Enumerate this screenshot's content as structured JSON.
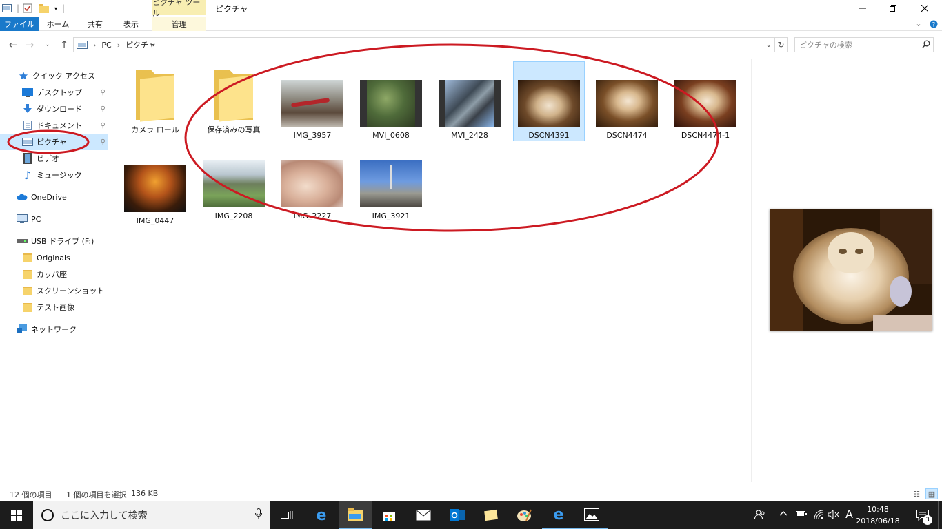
{
  "window": {
    "title": "ピクチャ",
    "context_tab_header": "ピクチャ ツール"
  },
  "ribbon": {
    "tabs": [
      "ファイル",
      "ホーム",
      "共有",
      "表示",
      "管理"
    ]
  },
  "address": {
    "path": [
      "PC",
      "ピクチャ"
    ]
  },
  "search": {
    "placeholder": "ピクチャの検索"
  },
  "nav_pane": {
    "items": [
      {
        "label": "クイック アクセス",
        "icon": "star-icon"
      },
      {
        "label": "デスクトップ",
        "icon": "desktop-icon",
        "pinned": true
      },
      {
        "label": "ダウンロード",
        "icon": "download-icon",
        "pinned": true
      },
      {
        "label": "ドキュメント",
        "icon": "document-icon",
        "pinned": true
      },
      {
        "label": "ピクチャ",
        "icon": "pictures-icon",
        "pinned": true,
        "selected": true
      },
      {
        "label": "ビデオ",
        "icon": "video-icon"
      },
      {
        "label": "ミュージック",
        "icon": "music-icon"
      },
      {
        "label": "OneDrive",
        "icon": "cloud-icon"
      },
      {
        "label": "PC",
        "icon": "pc-icon"
      },
      {
        "label": "USB ドライブ (F:)",
        "icon": "usb-drive-icon"
      },
      {
        "label": "Originals",
        "icon": "folder-icon"
      },
      {
        "label": "カッパ座",
        "icon": "folder-icon"
      },
      {
        "label": "スクリーンショット",
        "icon": "folder-icon"
      },
      {
        "label": "テスト画像",
        "icon": "folder-icon"
      },
      {
        "label": "ネットワーク",
        "icon": "network-icon"
      }
    ]
  },
  "files": [
    {
      "name": "カメラ ロール",
      "type": "folder"
    },
    {
      "name": "保存済みの写真",
      "type": "folder"
    },
    {
      "name": "IMG_3957",
      "type": "image"
    },
    {
      "name": "MVI_0608",
      "type": "video"
    },
    {
      "name": "MVI_2428",
      "type": "video"
    },
    {
      "name": "DSCN4391",
      "type": "image",
      "selected": true
    },
    {
      "name": "DSCN4474",
      "type": "image"
    },
    {
      "name": "DSCN4474-1",
      "type": "image"
    },
    {
      "name": "IMG_0447",
      "type": "image"
    },
    {
      "name": "IMG_2208",
      "type": "image"
    },
    {
      "name": "IMG_2227",
      "type": "image"
    },
    {
      "name": "IMG_3921",
      "type": "image"
    }
  ],
  "status": {
    "item_count": "12 個の項目",
    "selection": "1 個の項目を選択",
    "size": "136 KB"
  },
  "taskbar": {
    "search_placeholder": "ここに入力して検索",
    "time": "10:48",
    "date": "2018/06/18",
    "notification_count": "3",
    "ime": "A"
  },
  "colors": {
    "accent": "#1979ca",
    "selection": "#cce8ff",
    "annotation": "#cc1a22",
    "taskbar": "#1c1c1c"
  }
}
